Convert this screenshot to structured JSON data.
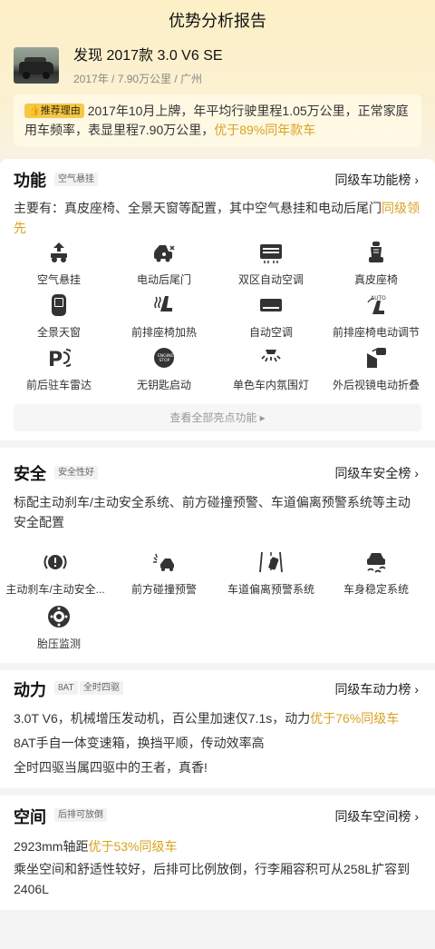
{
  "header": {
    "title": "优势分析报告"
  },
  "car": {
    "title": "发现 2017款 3.0 V6 SE",
    "subtitle": "2017年 / 7.90万公里 / 广州"
  },
  "reason": {
    "badge": "推荐理由",
    "text": "2017年10月上牌，年平均行驶里程1.05万公里，正常家庭用车频率，表显里程7.90万公里，",
    "highlight": "优于89%同年款车"
  },
  "function": {
    "title": "功能",
    "tag": "空气悬挂",
    "rank": "同级车功能榜 ›",
    "desc_text": "主要有：真皮座椅、全景天窗等配置，其中空气悬挂和电动后尾门",
    "desc_highlight": "同级领先",
    "features": [
      {
        "label": "空气悬挂",
        "icon": "air-suspension-icon"
      },
      {
        "label": "电动后尾门",
        "icon": "power-tailgate-icon"
      },
      {
        "label": "双区自动空调",
        "icon": "dual-zone-ac-icon"
      },
      {
        "label": "真皮座椅",
        "icon": "leather-seat-icon"
      },
      {
        "label": "全景天窗",
        "icon": "panoramic-sunroof-icon"
      },
      {
        "label": "前排座椅加热",
        "icon": "seat-heating-icon"
      },
      {
        "label": "自动空调",
        "icon": "auto-ac-icon"
      },
      {
        "label": "前排座椅电动调节",
        "icon": "power-seat-icon"
      },
      {
        "label": "前后驻车雷达",
        "icon": "parking-radar-icon"
      },
      {
        "label": "无钥匙启动",
        "icon": "keyless-start-icon"
      },
      {
        "label": "单色车内氛围灯",
        "icon": "ambient-light-icon"
      },
      {
        "label": "外后视镜电动折叠",
        "icon": "mirror-fold-icon"
      }
    ],
    "more": "查看全部亮点功能 ▸"
  },
  "safety": {
    "title": "安全",
    "tag": "安全性好",
    "rank": "同级车安全榜 ›",
    "desc": "标配主动刹车/主动安全系统、前方碰撞预警、车道偏离预警系统等主动安全配置",
    "features": [
      {
        "label": "主动刹车/主动安全...",
        "icon": "active-brake-icon"
      },
      {
        "label": "前方碰撞预警",
        "icon": "collision-warning-icon"
      },
      {
        "label": "车道偏离预警系统",
        "icon": "lane-departure-icon"
      },
      {
        "label": "车身稳定系统",
        "icon": "stability-control-icon"
      },
      {
        "label": "胎压监测",
        "icon": "tire-pressure-icon"
      }
    ]
  },
  "power": {
    "title": "动力",
    "tags": [
      "8AT",
      "全时四驱"
    ],
    "rank": "同级车动力榜 ›",
    "line1_text": "3.0T V6，机械增压发动机，百公里加速仅7.1s，动力",
    "line1_highlight": "优于76%同级车",
    "line2": "8AT手自一体变速箱，换挡平顺，传动效率高",
    "line3": "全时四驱当属四驱中的王者，真香!"
  },
  "space": {
    "title": "空间",
    "tag": "后排可放倒",
    "rank": "同级车空间榜 ›",
    "line1_text": "2923mm轴距",
    "line1_highlight": "优于53%同级车",
    "desc": "乘坐空间和舒适性较好，后排可比例放倒，行李厢容积可从258L扩容到2406L"
  },
  "colors": {
    "accent": "#d9a21e",
    "badge": "#f5c84a",
    "icon": "#333333"
  }
}
